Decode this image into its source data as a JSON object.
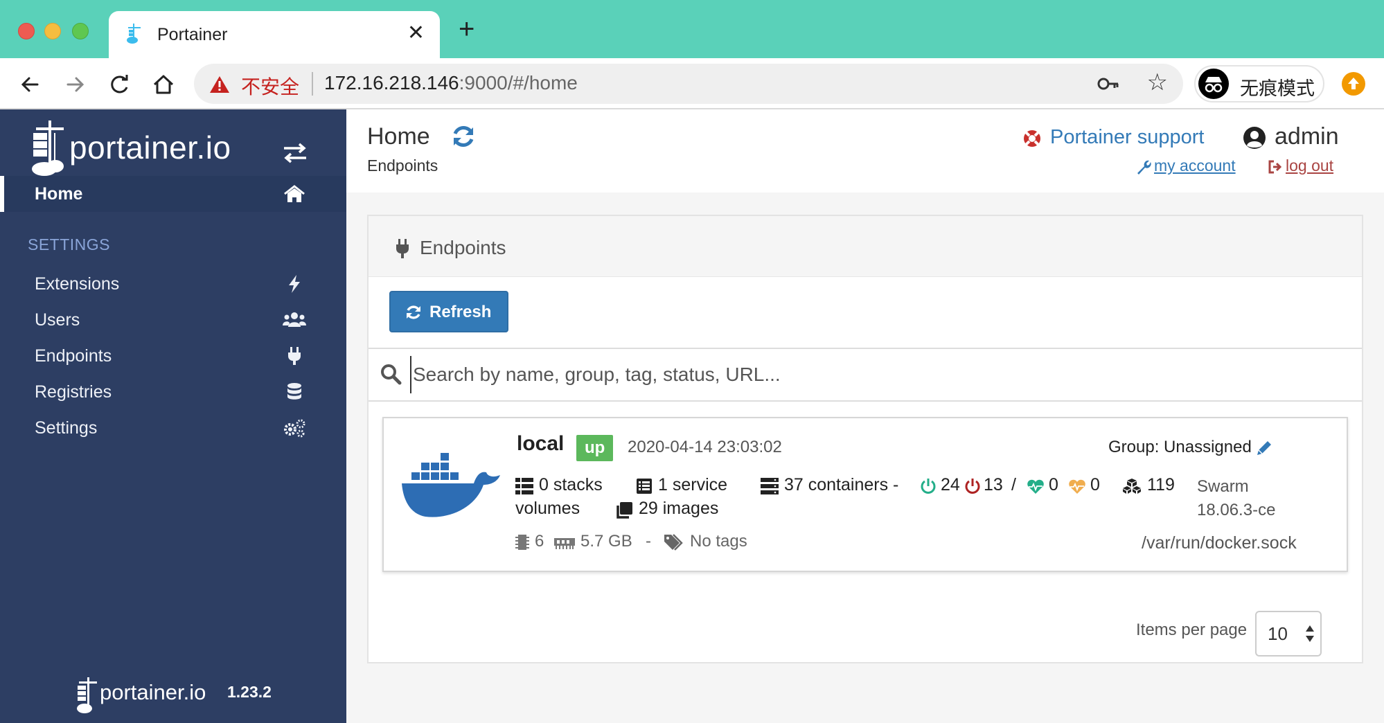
{
  "browser": {
    "tab_title": "Portainer",
    "security_label": "不安全",
    "url_host": "172.16.218.146",
    "url_rest": ":9000/#/home",
    "incognito_label": "无痕模式"
  },
  "sidebar": {
    "brand": "portainer.io",
    "items": [
      {
        "label": "Home",
        "icon": "home-icon"
      },
      {
        "label": "Extensions",
        "icon": "bolt-icon"
      },
      {
        "label": "Users",
        "icon": "users-icon"
      },
      {
        "label": "Endpoints",
        "icon": "plug-icon"
      },
      {
        "label": "Registries",
        "icon": "database-icon"
      },
      {
        "label": "Settings",
        "icon": "cogs-icon"
      }
    ],
    "section_label": "SETTINGS",
    "footer_brand": "portainer.io",
    "version": "1.23.2"
  },
  "header": {
    "title": "Home",
    "breadcrumb": "Endpoints",
    "support_label": "Portainer support",
    "username": "admin",
    "my_account": " my account ",
    "log_out": " log out"
  },
  "panel": {
    "title": "Endpoints",
    "refresh_label": "Refresh",
    "search_placeholder": "Search by name, group, tag, status, URL..."
  },
  "endpoint": {
    "name": "local",
    "status": "up",
    "date": "2020-04-14 23:03:02",
    "group": "Group: Unassigned",
    "stacks": "0 stacks",
    "services": "1 service",
    "containers": "37 containers -",
    "running": "24",
    "stopped": "13",
    "separator": "/",
    "healthy": "0",
    "unhealthy": "0",
    "volumes_count": "119",
    "volumes_label": "volumes",
    "images": "29 images",
    "swarm_line1": "Swarm",
    "swarm_line2": "18.06.3-ce",
    "cpu": "6",
    "memory": "5.7 GB",
    "dash": "-",
    "tags": "No tags",
    "socket": "/var/run/docker.sock"
  },
  "pagination": {
    "label": "Items per page",
    "value": "10"
  },
  "colors": {
    "sidebar_bg": "#2d3e63",
    "primary": "#337ab7",
    "status_up": "#5cb85c",
    "tab_bar": "#5ad1b9",
    "running": "#23ae89",
    "stopped": "#ae2323",
    "unhealthy": "#f0ad4e"
  }
}
